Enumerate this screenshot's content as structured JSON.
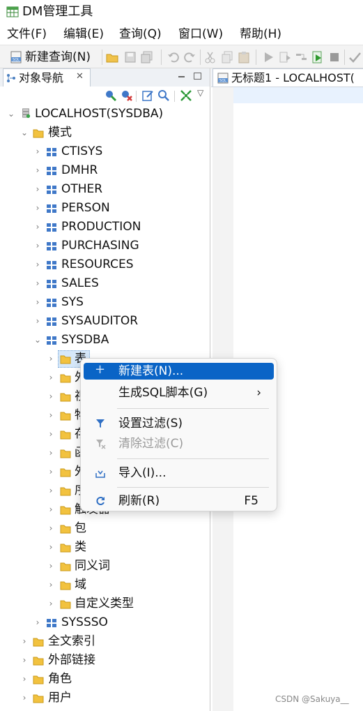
{
  "app": {
    "title": "DM管理工具"
  },
  "menu": {
    "items": [
      "文件(F)",
      "编辑(E)",
      "查询(Q)",
      "窗口(W)",
      "帮助(H)"
    ]
  },
  "toolbar": {
    "new_query_label": "新建查询(N)"
  },
  "nav": {
    "tab_label": "对象导航",
    "root": "LOCALHOST(SYSDBA)",
    "schema_folder": "模式",
    "schemas": [
      "CTISYS",
      "DMHR",
      "OTHER",
      "PERSON",
      "PRODUCTION",
      "PURCHASING",
      "RESOURCES",
      "SALES",
      "SYS",
      "SYSAUDITOR"
    ],
    "expanded_schema": "SYSDBA",
    "sysdba_children": [
      "表",
      "外",
      "视",
      "物",
      "存",
      "函",
      "外",
      "序",
      "触发器",
      "包",
      "类",
      "同义词",
      "域",
      "自定义类型"
    ],
    "after_schema": "SYSSSO",
    "top_folders": [
      "全文索引",
      "外部链接",
      "角色",
      "用户"
    ]
  },
  "editor": {
    "tab_label": "无标题1 - LOCALHOST("
  },
  "context_menu": {
    "new_table": "新建表(N)...",
    "gen_sql": "生成SQL脚本(G)",
    "gen_sql_arrow": "›",
    "set_filter": "设置过滤(S)",
    "clear_filter": "清除过滤(C)",
    "import": "导入(I)...",
    "refresh": "刷新(R)",
    "refresh_shortcut": "F5"
  },
  "watermark": "CSDN @Sakuya__"
}
